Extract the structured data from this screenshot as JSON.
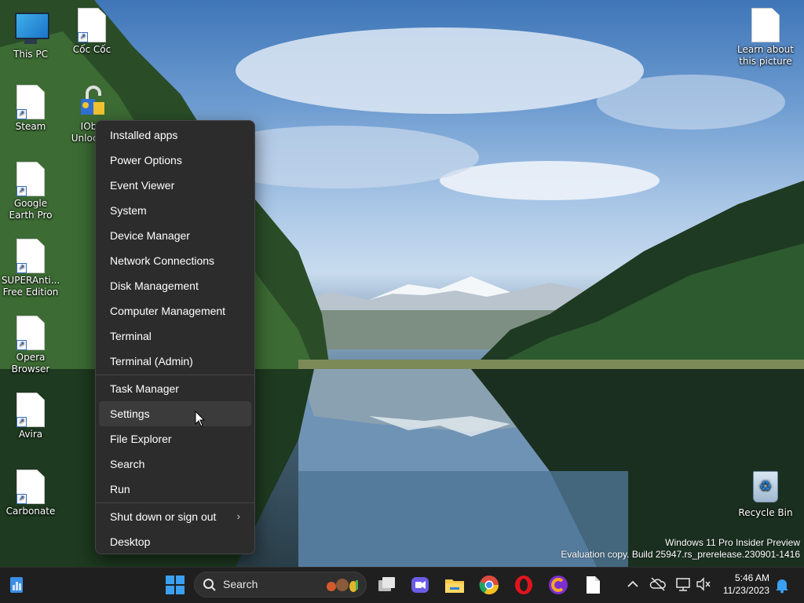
{
  "desktop": {
    "icons_left": [
      {
        "label": "This PC",
        "type": "monitor"
      },
      {
        "label": "Cốc Cốc",
        "type": "file"
      },
      {
        "label": "Steam",
        "type": "file"
      },
      {
        "label": "IObit Unlocker",
        "type": "lock"
      },
      {
        "label": "Google Earth Pro",
        "type": "file"
      },
      {
        "label": "SUPERAnti... Free Edition",
        "type": "file"
      },
      {
        "label": "Opera Browser",
        "type": "file"
      },
      {
        "label": "Avira",
        "type": "file"
      },
      {
        "label": "Carbonate",
        "type": "file"
      }
    ],
    "icons_right": [
      {
        "label": "Learn about this picture",
        "type": "file"
      },
      {
        "label": "Recycle Bin",
        "type": "bin"
      }
    ],
    "partial_label": "IOb\nUnloc"
  },
  "context_menu": {
    "group1": [
      "Installed apps",
      "Power Options",
      "Event Viewer",
      "System",
      "Device Manager",
      "Network Connections",
      "Disk Management",
      "Computer Management",
      "Terminal",
      "Terminal (Admin)"
    ],
    "group2": [
      "Task Manager",
      "Settings",
      "File Explorer",
      "Search",
      "Run"
    ],
    "group3": [
      "Shut down or sign out",
      "Desktop"
    ],
    "hovered": "Settings"
  },
  "watermark": {
    "line1": "Windows 11 Pro Insider Preview",
    "line2": "Evaluation copy. Build 25947.rs_prerelease.230901-1416"
  },
  "taskbar": {
    "search_label": "Search",
    "time": "5:46 AM",
    "date": "11/23/2023"
  },
  "colors": {
    "menu_bg": "#2c2c2c",
    "taskbar_bg": "#1f1f1f",
    "accent": "#0078d4"
  }
}
